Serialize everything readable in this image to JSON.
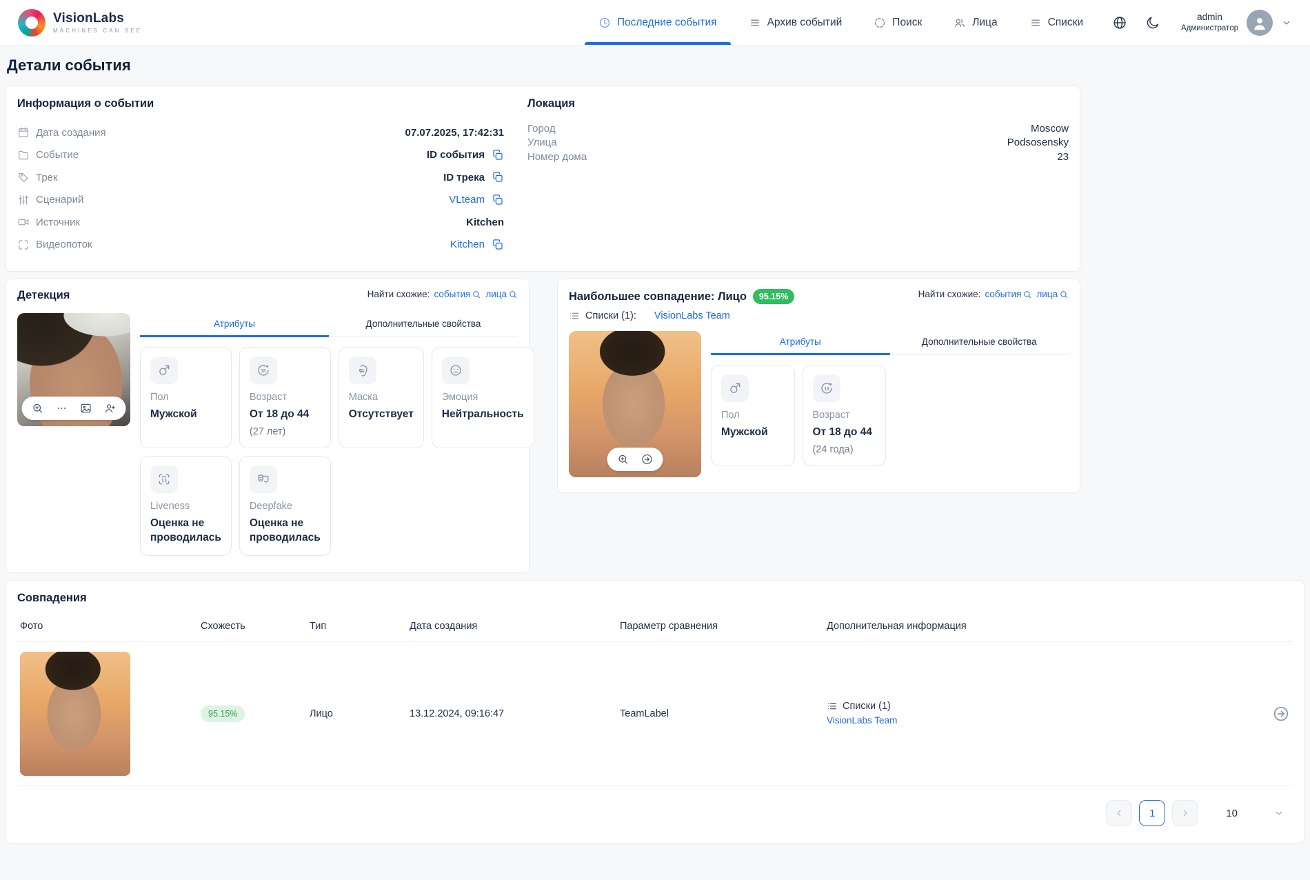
{
  "colors": {
    "accent": "#1b6ce3",
    "badge_green": "#2fbe5f",
    "badge_soft_bg": "#ddf3e4",
    "badge_soft_text": "#2aa24e"
  },
  "header": {
    "brand": {
      "name": "VisionLabs",
      "tagline": "MACHINES CAN SEE"
    },
    "nav": [
      {
        "label": "Последние события",
        "icon": "clock-icon",
        "active": true
      },
      {
        "label": "Архив событий",
        "icon": "archive-list-icon",
        "active": false
      },
      {
        "label": "Поиск",
        "icon": "search-scope-icon",
        "active": false
      },
      {
        "label": "Лица",
        "icon": "faces-icon",
        "active": false
      },
      {
        "label": "Списки",
        "icon": "lists-icon",
        "active": false
      }
    ],
    "user": {
      "name": "admin",
      "role": "Администратор"
    }
  },
  "page": {
    "title": "Детали события"
  },
  "event_info": {
    "title": "Информация о событии",
    "rows": [
      {
        "icon": "calendar-icon",
        "label": "Дата создания",
        "value": "07.07.2025, 17:42:31"
      },
      {
        "icon": "folder-icon",
        "label": "Событие",
        "value": "ID события"
      },
      {
        "icon": "tag-icon",
        "label": "Трек",
        "value": "ID трека"
      },
      {
        "icon": "sliders-icon",
        "label": "Сценарий",
        "value": "VLteam"
      },
      {
        "icon": "video-camera-icon",
        "label": "Источник",
        "value": "Kitchen"
      },
      {
        "icon": "scan-frame-icon",
        "label": "Видеопоток",
        "value": "Kitchen"
      }
    ]
  },
  "location": {
    "title": "Локация",
    "rows": [
      {
        "label": "Город",
        "value": "Moscow"
      },
      {
        "label": "Улица",
        "value": "Podsosensky"
      },
      {
        "label": "Номер дома",
        "value": "23"
      }
    ]
  },
  "detection": {
    "title": "Детекция",
    "find_similar": {
      "label": "Найти схожие:",
      "events_link": "события",
      "faces_link": "лица"
    },
    "tabs": {
      "attributes": "Атрибуты",
      "extra": "Дополнительные свойства"
    },
    "cards": [
      {
        "icon": "male-icon",
        "label": "Пол",
        "value": "Мужской",
        "sub": ""
      },
      {
        "icon": "age-icon",
        "label": "Возраст",
        "value": "От 18 до 44",
        "sub": "(27 лет)"
      },
      {
        "icon": "mask-icon",
        "label": "Маска",
        "value": "Отсутствует",
        "sub": ""
      },
      {
        "icon": "emotion-icon",
        "label": "Эмоция",
        "value": "Нейтральность",
        "sub": ""
      },
      {
        "icon": "liveness-icon",
        "label": "Liveness",
        "value": "Оценка не проводилась",
        "sub": ""
      },
      {
        "icon": "deepfake-icon",
        "label": "Deepfake",
        "value": "Оценка не проводилась",
        "sub": ""
      }
    ]
  },
  "best_match": {
    "title": "Наибольшее совпадение: Лицо",
    "score": "95.15%",
    "lists": {
      "label": "Списки (1):",
      "link": "VisionLabs Team"
    },
    "find_similar": {
      "label": "Найти схожие:",
      "events_link": "события",
      "faces_link": "лица"
    },
    "tabs": {
      "attributes": "Атрибуты",
      "extra": "Дополнительные свойства"
    },
    "cards": [
      {
        "icon": "male-icon",
        "label": "Пол",
        "value": "Мужской",
        "sub": ""
      },
      {
        "icon": "age-icon",
        "label": "Возраст",
        "value": "От 18 до 44",
        "sub": "(24 года)"
      }
    ]
  },
  "matches": {
    "title": "Совпадения",
    "columns": [
      "Фото",
      "Схожесть",
      "Тип",
      "Дата создания",
      "Параметр сравнения",
      "Дополнительная информация"
    ],
    "rows": [
      {
        "similarity": "95.15%",
        "type": "Лицо",
        "created": "13.12.2024, 09:16:47",
        "compare_param": "TeamLabel",
        "extra": {
          "label": "Списки (1)",
          "link": "VisionLabs Team"
        }
      }
    ]
  },
  "pagination": {
    "current_page": "1",
    "page_size": "10"
  }
}
